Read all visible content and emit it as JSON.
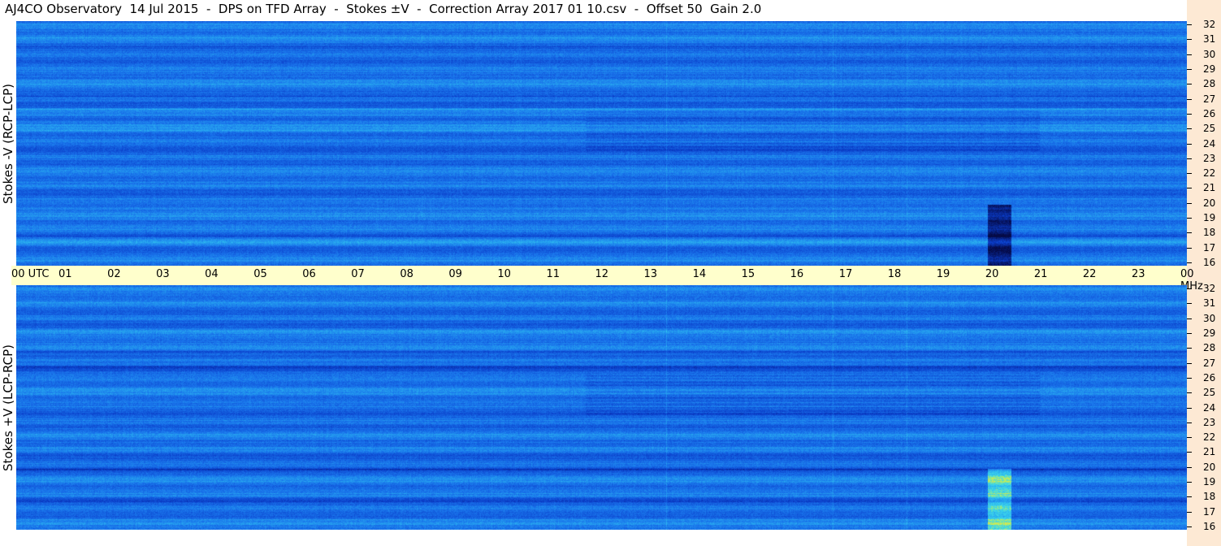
{
  "title": "AJ4CO Observatory  14 Jul 2015  -  DPS on TFD Array  -  Stokes ±V  -  Correction Array 2017 01 10.csv  -  Offset 50  Gain 2.0",
  "chart_data": [
    {
      "type": "heatmap",
      "name": "top",
      "ylabel": "Stokes -V (RCP-LCP)",
      "y_ticks": [
        "32",
        "31",
        "30",
        "29",
        "28",
        "27",
        "26",
        "25",
        "24",
        "23",
        "22",
        "21",
        "20",
        "19",
        "18",
        "17",
        "16"
      ],
      "ylim": [
        16,
        32
      ]
    },
    {
      "type": "heatmap",
      "name": "bottom",
      "ylabel": "Stokes +V (LCP-RCP)",
      "y_ticks": [
        "32",
        "31",
        "30",
        "29",
        "28",
        "27",
        "26",
        "25",
        "24",
        "23",
        "22",
        "21",
        "20",
        "19",
        "18",
        "17",
        "16"
      ],
      "ylim": [
        16,
        32
      ]
    }
  ],
  "time_axis": {
    "labels": [
      "00  UTC",
      "01",
      "02",
      "03",
      "04",
      "05",
      "06",
      "07",
      "08",
      "09",
      "10",
      "11",
      "12",
      "13",
      "14",
      "15",
      "16",
      "17",
      "18",
      "19",
      "20",
      "21",
      "22",
      "23",
      "00 MHz"
    ]
  },
  "colors": {
    "base": "#1e72e6",
    "dark": "#0a2a9a",
    "light": "#35c8f0",
    "hot_green": "#b9f25a",
    "hot_red": "#ff3040",
    "axis_band": "#ffffcc",
    "right_strip": "#fde9d4"
  }
}
